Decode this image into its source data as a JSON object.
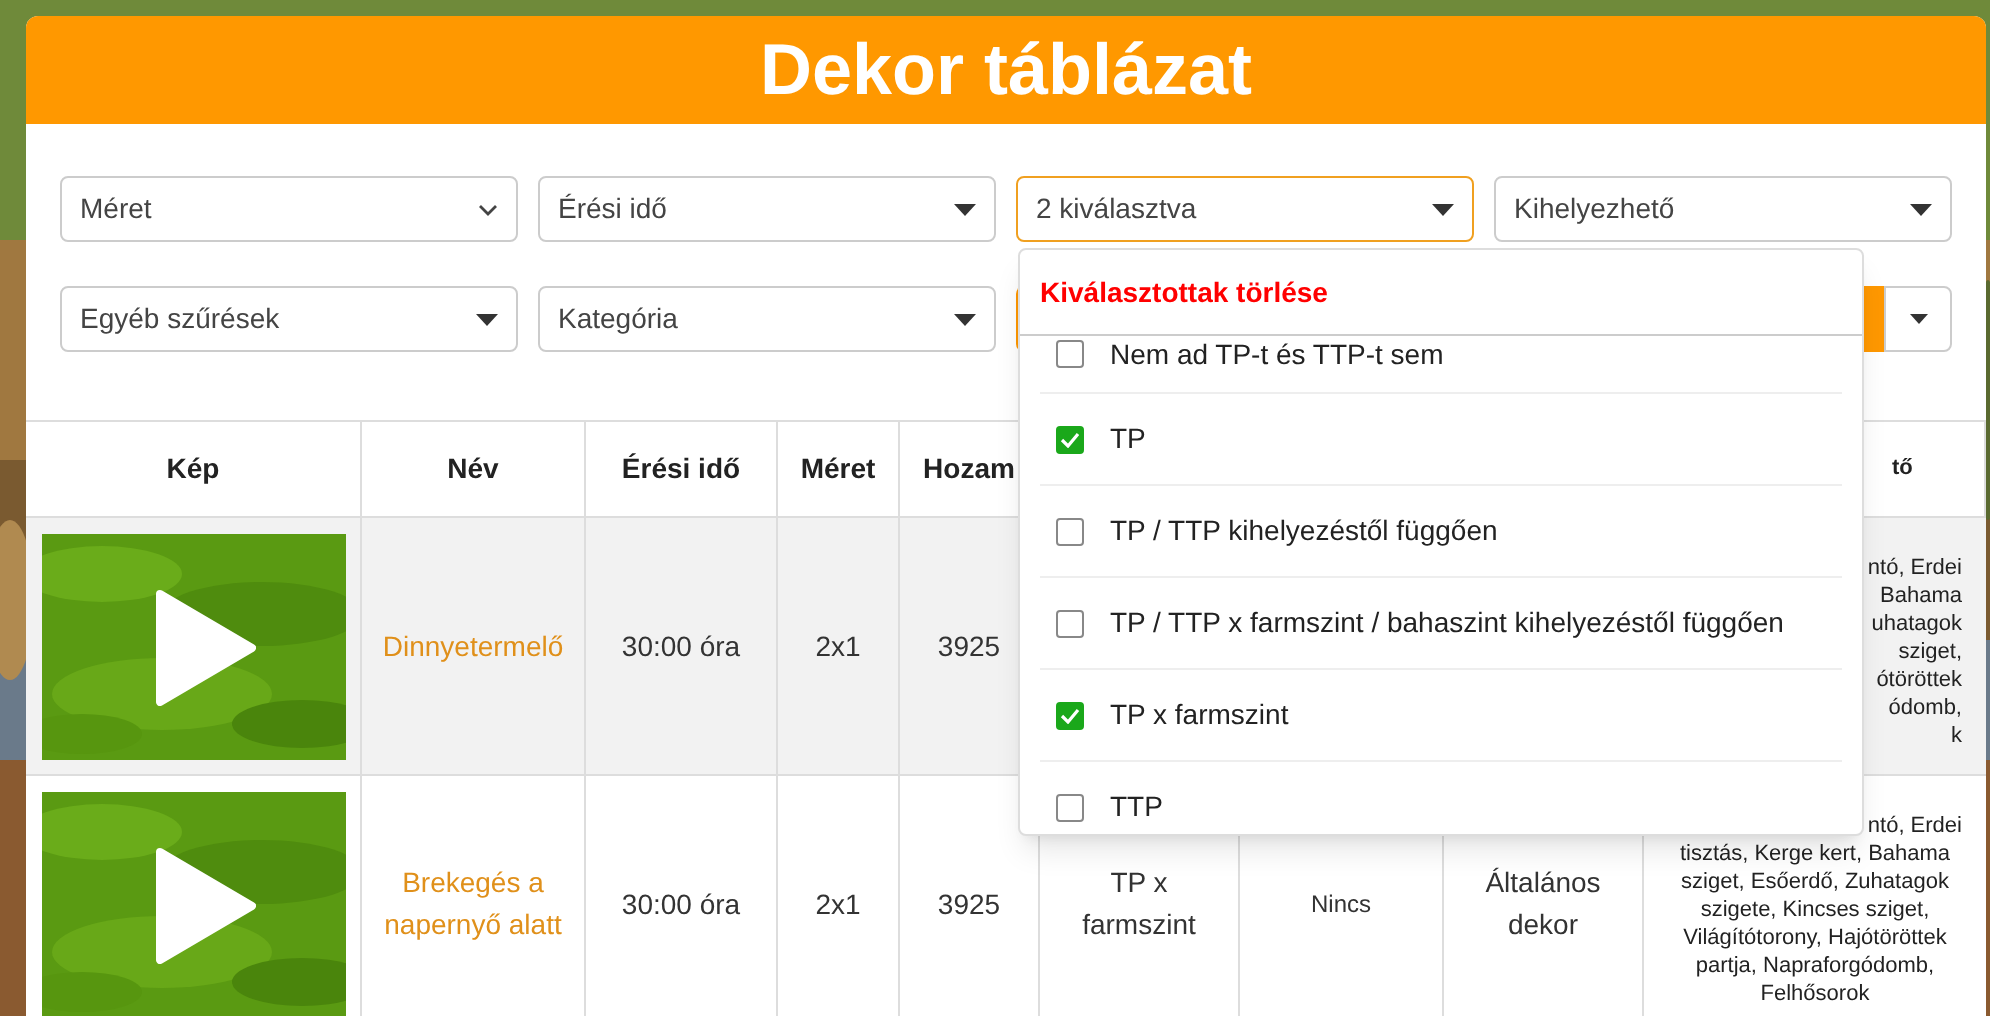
{
  "title": "Dekor táblázat",
  "filters": [
    {
      "kind": "native-select",
      "label": "Méret",
      "open": false
    },
    {
      "kind": "select",
      "label": "Érési idő",
      "open": false
    },
    {
      "kind": "select",
      "label": "2 kiválasztva",
      "open": true
    },
    {
      "kind": "select",
      "label": "Kihelyezhető",
      "open": false
    },
    {
      "kind": "select",
      "label": "Egyéb szűrések",
      "open": false
    },
    {
      "kind": "select",
      "label": "Kategória",
      "open": false
    },
    {
      "kind": "split-button",
      "open": false
    }
  ],
  "dropdown": {
    "clear_label": "Kiválasztottak törlése",
    "options": [
      {
        "label": "Nem ad TP-t és TTP-t sem",
        "checked": false
      },
      {
        "label": "TP",
        "checked": true
      },
      {
        "label": "TP / TTP kihelyezéstől függően",
        "checked": false
      },
      {
        "label": "TP / TTP x farmszint / bahaszint kihelyezéstől függően",
        "checked": false
      },
      {
        "label": "TP x farmszint",
        "checked": true
      },
      {
        "label": "TTP",
        "checked": false
      }
    ]
  },
  "table": {
    "columns": [
      {
        "label": "Kép"
      },
      {
        "label": "Név"
      },
      {
        "label": "Érési idő"
      },
      {
        "label": "Méret"
      },
      {
        "label": "Hozam"
      },
      {},
      {},
      {},
      {
        "label": "tő"
      }
    ],
    "rows": [
      {
        "name": "Dinnyetermelő",
        "time": "30:00 óra",
        "size": "2x1",
        "yield": "3925",
        "column_9": {
          "fragment_lines": [
            "ntó, Erdei",
            "Bahama",
            "uhatagok",
            "sziget,",
            "ótöröttek",
            "ódomb,",
            "k"
          ]
        }
      },
      {
        "name": "Brekegés a napernyő alatt",
        "time": "30:00 óra",
        "size": "2x1",
        "yield": "3925",
        "column_6": "TP x farmszint",
        "column_7": "Nincs",
        "column_8": "Általános dekor",
        "column_9": {
          "fragment_lines": [
            "ntó, Erdei"
          ],
          "lines": [
            "tisztás, Kerge kert, Bahama",
            "sziget, Esőerdő, Zuhatagok",
            "szigete, Kincses sziget,",
            "Világítótorony, Hajótöröttek",
            "partja, Napraforgódomb,",
            "Felhősorok"
          ]
        }
      }
    ]
  }
}
